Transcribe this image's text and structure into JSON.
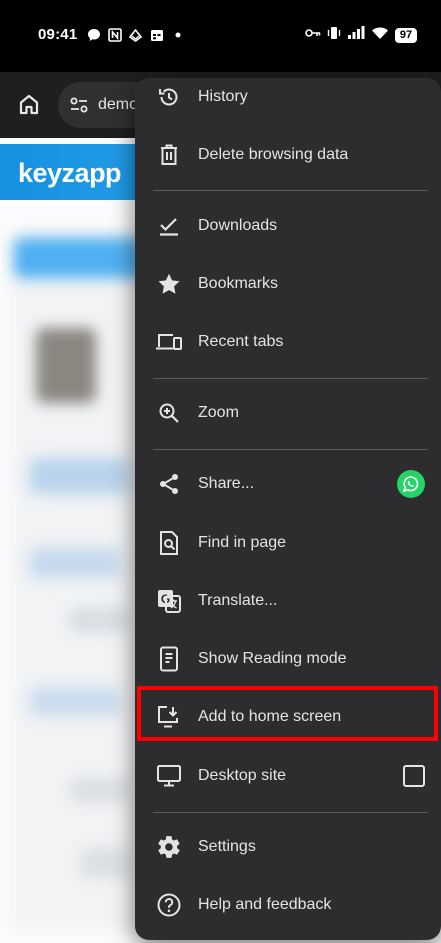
{
  "status_bar": {
    "time": "09:41",
    "battery": "97",
    "icons": [
      "chat-bubble-icon",
      "nfc-icon",
      "sync-icon",
      "calendar-icon",
      "dot-icon",
      "key-icon",
      "vibrate-icon",
      "signal-icon",
      "wifi-icon",
      "battery-icon"
    ]
  },
  "toolbar": {
    "url_text": "demo",
    "icons": [
      "home-icon",
      "site-settings-icon"
    ]
  },
  "page": {
    "logo_text": "keyzapp"
  },
  "menu": {
    "items": [
      {
        "label": "History",
        "icon": "history-icon"
      },
      {
        "label": "Delete browsing data",
        "icon": "trash-icon"
      },
      {
        "label": "Downloads",
        "icon": "download-check-icon"
      },
      {
        "label": "Bookmarks",
        "icon": "star-icon"
      },
      {
        "label": "Recent tabs",
        "icon": "devices-icon"
      },
      {
        "label": "Zoom",
        "icon": "zoom-in-icon"
      },
      {
        "label": "Share...",
        "icon": "share-icon",
        "trailing": "whatsapp-icon"
      },
      {
        "label": "Find in page",
        "icon": "find-in-page-icon"
      },
      {
        "label": "Translate...",
        "icon": "translate-icon"
      },
      {
        "label": "Show Reading mode",
        "icon": "reading-mode-icon"
      },
      {
        "label": "Add to home screen",
        "icon": "add-to-home-screen-icon",
        "highlighted": true
      },
      {
        "label": "Desktop site",
        "icon": "monitor-icon",
        "trailing": "checkbox",
        "checked": false
      },
      {
        "label": "Settings",
        "icon": "gear-icon"
      },
      {
        "label": "Help and feedback",
        "icon": "help-icon"
      }
    ]
  },
  "colors": {
    "menu_bg": "#2d2d2f",
    "highlight": "#ff0000",
    "banner": "#1f9ae8",
    "whatsapp": "#25d366"
  }
}
